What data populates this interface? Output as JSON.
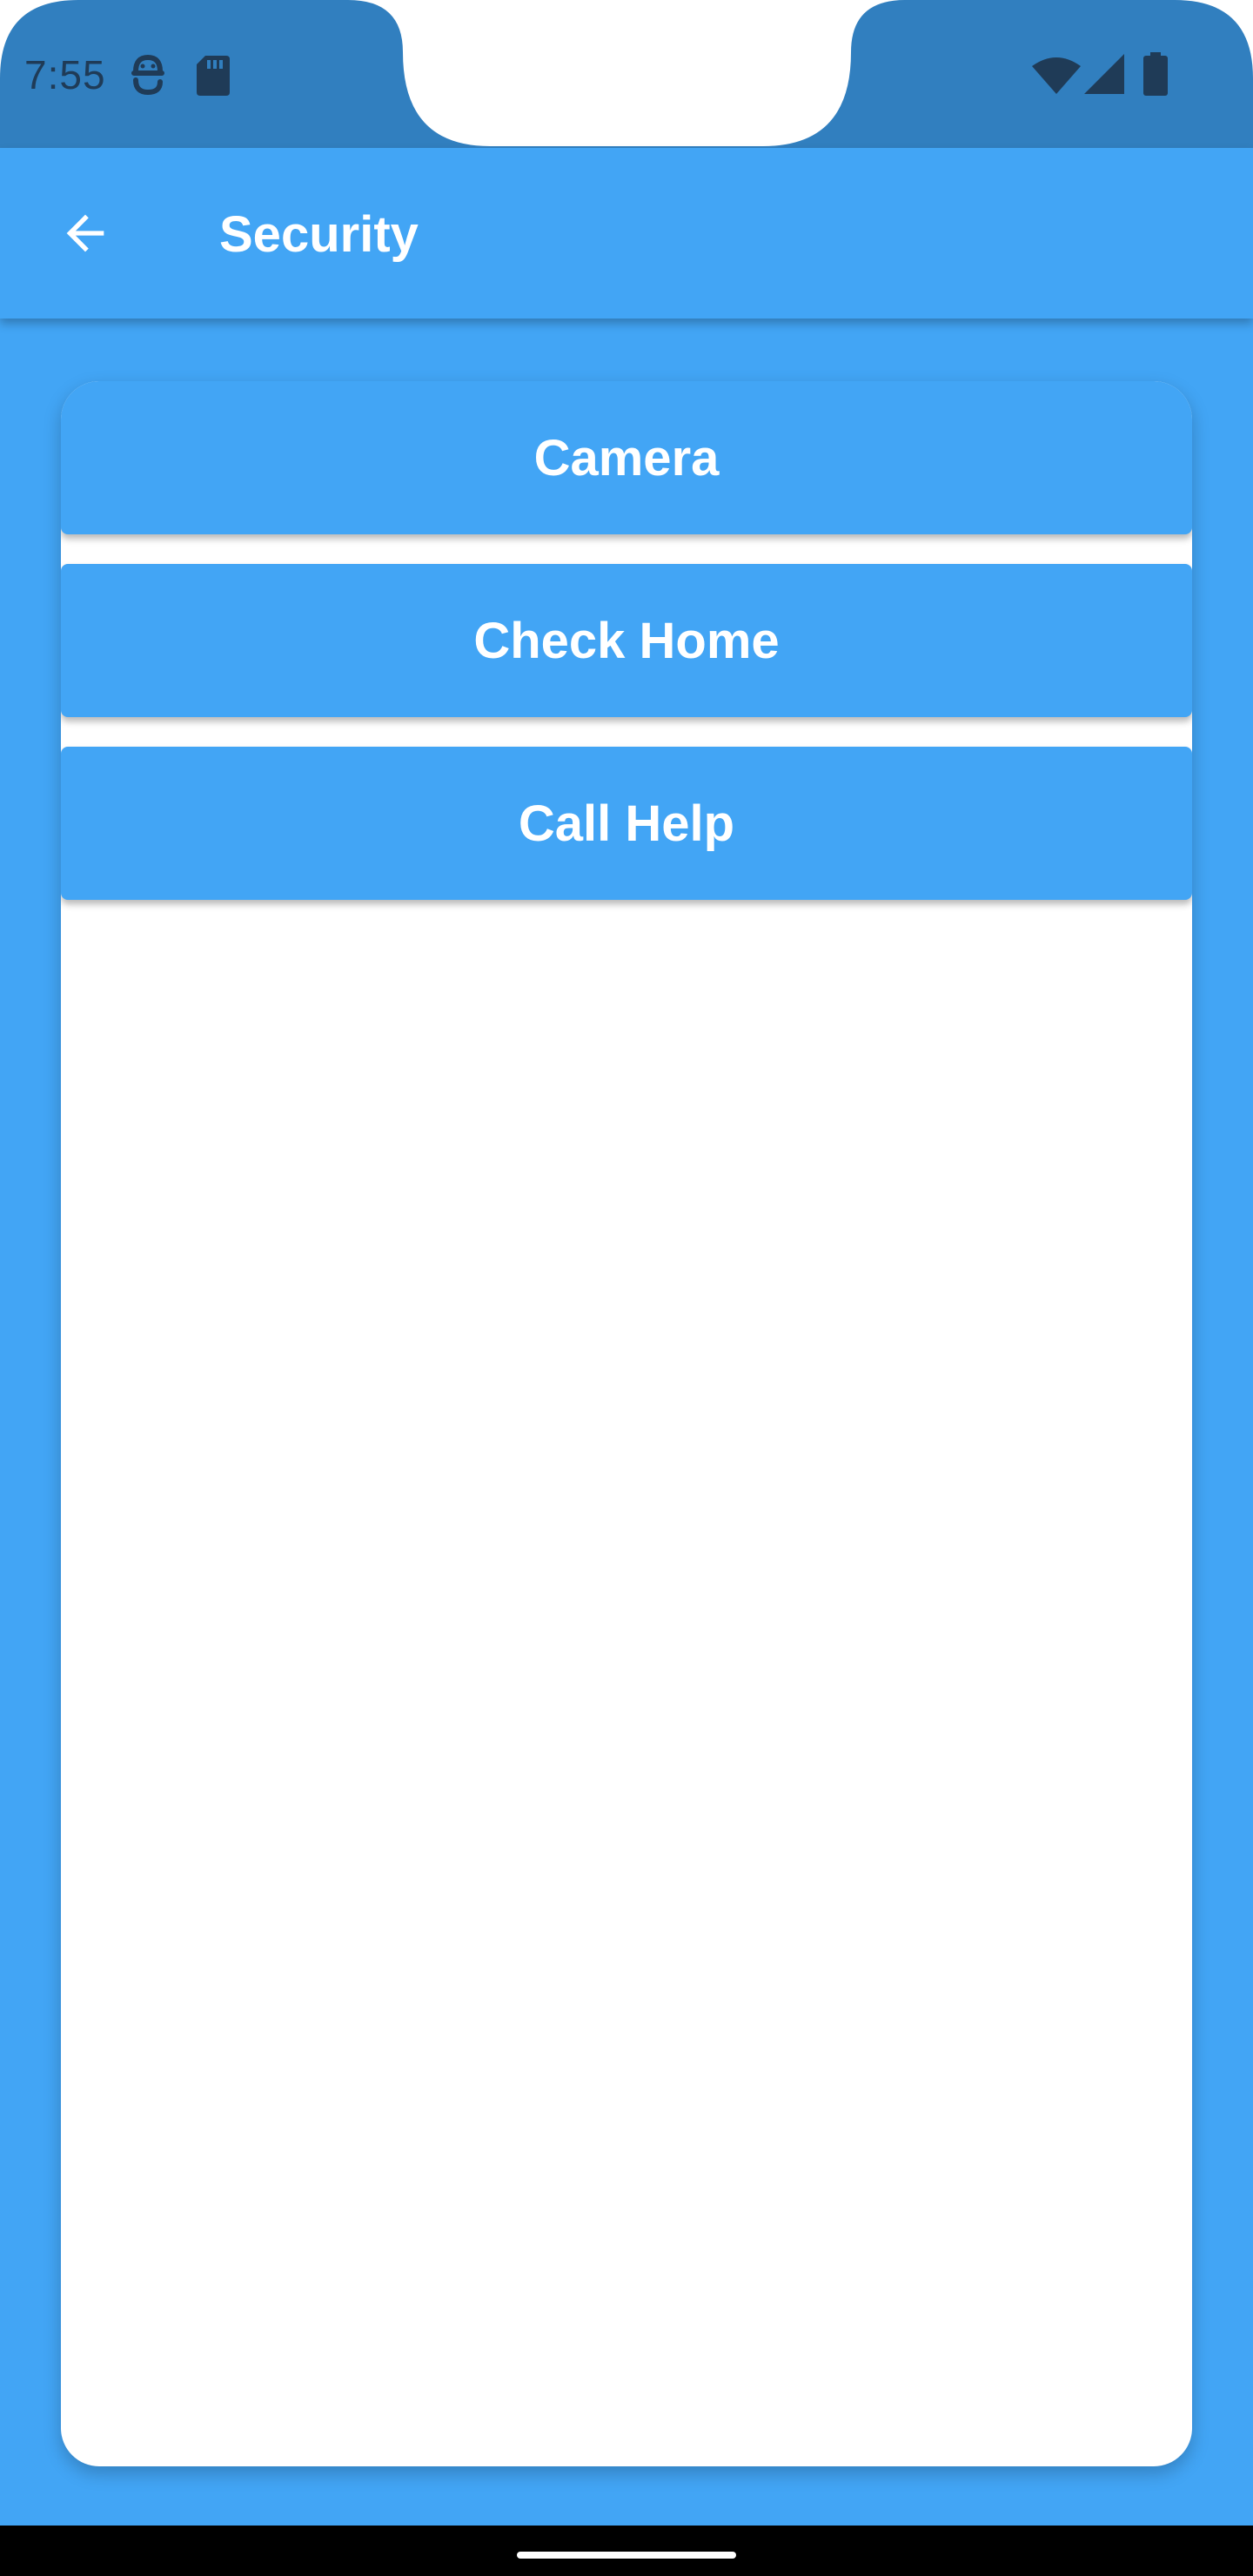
{
  "status_bar": {
    "time": "7:55",
    "icons": [
      "android-debug-icon",
      "sd-card-icon",
      "wifi-icon",
      "cellular-signal-icon",
      "battery-icon"
    ],
    "color": "#317fbf"
  },
  "header": {
    "title": "Security",
    "back_icon": "arrow-back-icon",
    "color": "#42a5f5"
  },
  "actions": [
    {
      "label": "Camera"
    },
    {
      "label": "Check Home"
    },
    {
      "label": "Call Help"
    }
  ],
  "theme": {
    "accent": "#42a5f5",
    "card": "#ffffff",
    "nav_bar": "#000000"
  }
}
